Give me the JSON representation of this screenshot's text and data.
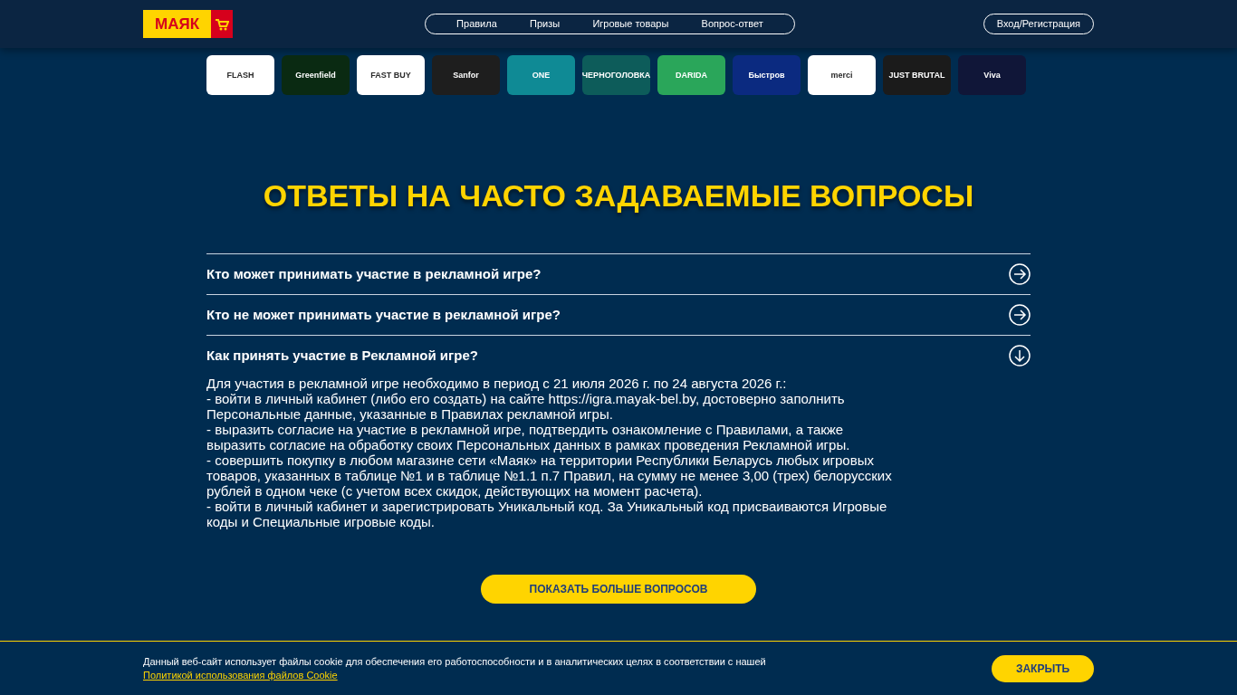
{
  "header": {
    "logo": "МАЯК",
    "nav": [
      {
        "label": "Правила"
      },
      {
        "label": "Призы"
      },
      {
        "label": "Игровые товары"
      },
      {
        "label": "Вопрос-ответ"
      }
    ],
    "login": "Вход/Регистрация"
  },
  "brands": [
    {
      "label": "FLASH",
      "color": "#ffffff"
    },
    {
      "label": "Greenfield",
      "color": "#0a2a12"
    },
    {
      "label": "FAST BUY",
      "color": "#ffffff"
    },
    {
      "label": "Sanfor",
      "color": "#1e1e1e"
    },
    {
      "label": "ONE",
      "color": "#0f8a95"
    },
    {
      "label": "ЧЕРНОГОЛОВКА",
      "color": "#0d5c5a"
    },
    {
      "label": "DARIDA",
      "color": "#2aa65a"
    },
    {
      "label": "Быстров",
      "color": "#0b2a80"
    },
    {
      "label": "merci",
      "color": "#ffffff"
    },
    {
      "label": "JUST BRUTAL",
      "color": "#1b1b1b"
    },
    {
      "label": "Viva",
      "color": "#101638"
    }
  ],
  "faq": {
    "title": "ОТВЕТЫ НА ЧАСТО ЗАДАВАЕМЫЕ ВОПРОСЫ",
    "items": [
      {
        "question": "Кто может принимать участие в рекламной игре?",
        "expanded": false
      },
      {
        "question": "Кто не может принимать участие в рекламной игре?",
        "expanded": false
      },
      {
        "question": "Как принять участие в Рекламной игре?",
        "expanded": true,
        "answer": [
          "Для участия в рекламной игре необходимо в период с 21 июля 2026 г. по 24 августа 2026 г.:",
          "- войти в личный кабинет (либо его создать) на сайте https://igra.mayak-bel.by, достоверно заполнить Персональные данные, указанные в Правилах рекламной игры.",
          "- выразить согласие на участие в рекламной игре, подтвердить ознакомление с Правилами, а также выразить согласие на обработку своих Персональных данных в рамках проведения Рекламной игры.",
          "- совершить покупку в любом магазине сети «Маяк» на территории Республики Беларусь любых игровых товаров, указанных в таблице №1 и в таблице №1.1 п.7 Правил, на сумму не менее 3,00 (трех) белорусских рублей в одном чеке (с учетом всех скидок, действующих на момент расчета).",
          "- войти в личный кабинет и зарегистрировать Уникальный код. За Уникальный код присваиваются Игровые коды и Специальные игровые коды."
        ]
      }
    ],
    "more_button": "ПОКАЗАТЬ БОЛЬШЕ ВОПРОСОВ"
  },
  "cookie": {
    "text": "Данный веб-сайт использует файлы cookie для обеспечения его работоспособности и в аналитических целях в соответствии с нашей",
    "link": "Политикой использования файлов Cookie",
    "close": "ЗАКРЫТЬ"
  }
}
